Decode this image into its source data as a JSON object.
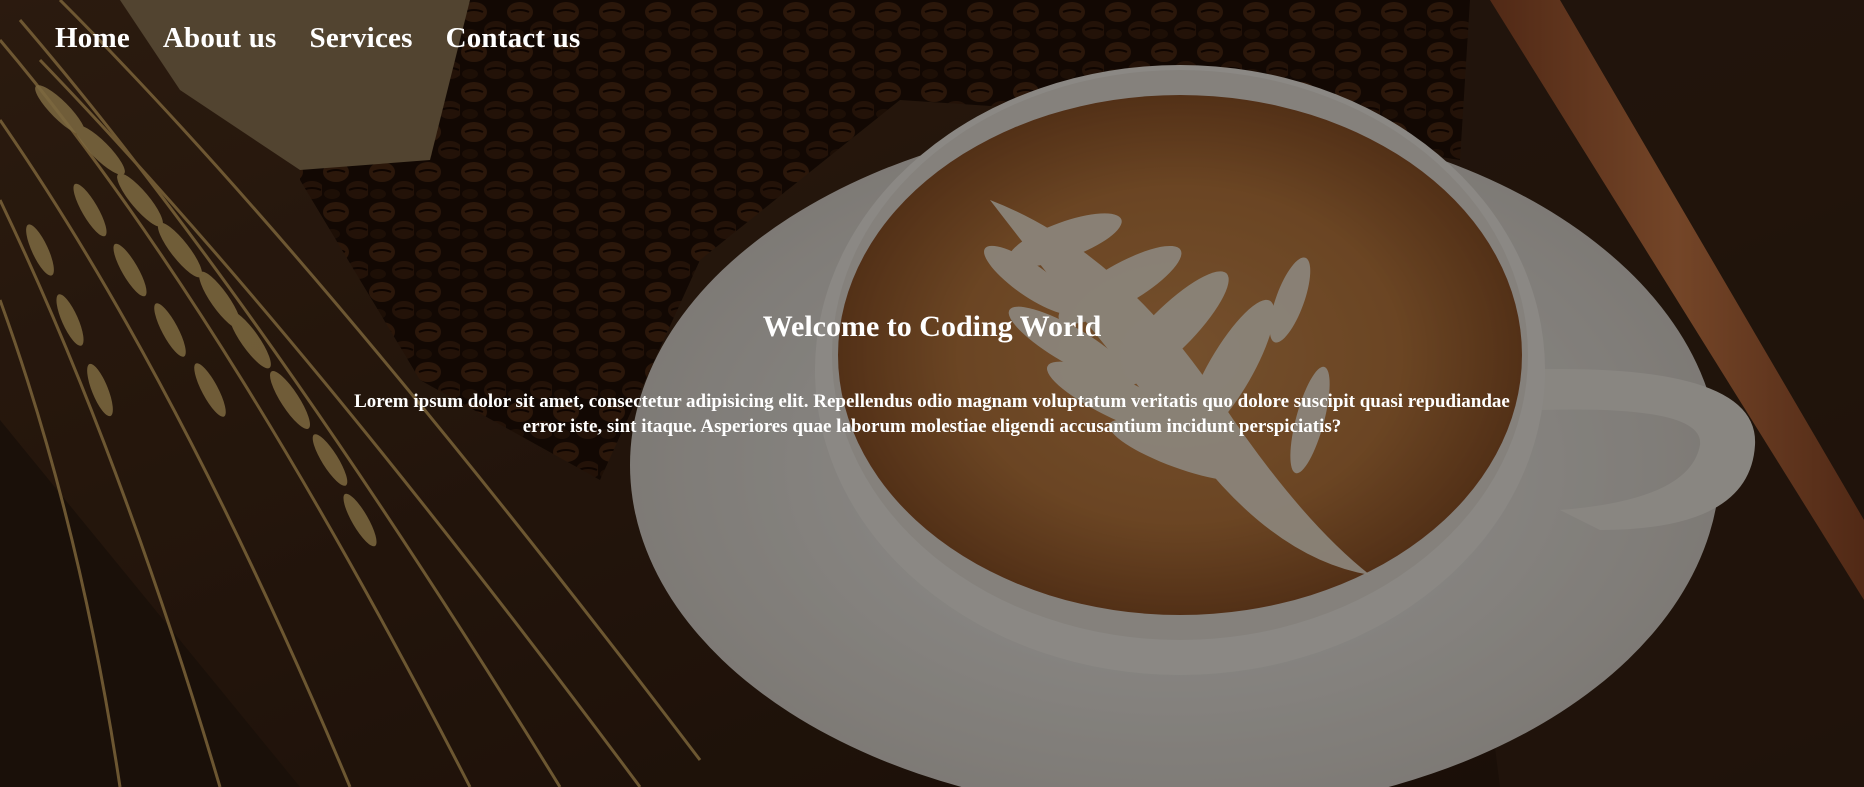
{
  "nav": {
    "items": [
      {
        "label": "Home"
      },
      {
        "label": "About us"
      },
      {
        "label": "Services"
      },
      {
        "label": "Contact us"
      }
    ]
  },
  "hero": {
    "title": "Welcome to Coding World",
    "text": "Lorem ipsum dolor sit amet, consectetur adipisicing elit. Repellendus odio magnam voluptatum veritatis quo dolore suscipit quasi repudiandae error iste, sint itaque. Asperiores quae laborum molestiae eligendi accusantium incidunt perspiciatis?"
  },
  "background": {
    "subject": "latte-art-coffee-cup-with-coffee-beans-wheat-and-cinnamon",
    "colors": {
      "wood": "#3b2414",
      "beans": "#2a160b",
      "crema": "#c98a4e",
      "cup": "#f3efe9",
      "wheat": "#c9a35c",
      "cinnamon": "#b5653a"
    }
  }
}
